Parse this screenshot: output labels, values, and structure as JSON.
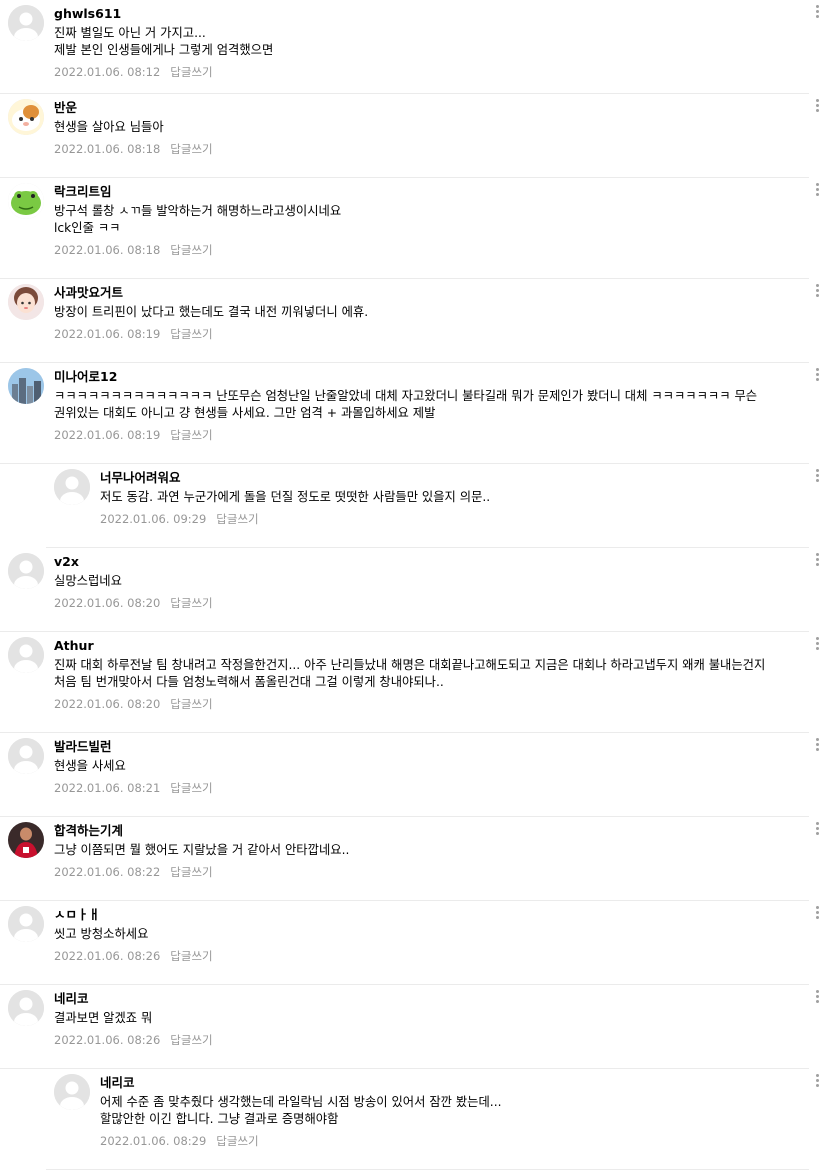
{
  "comments": [
    {
      "nick": "ghwls611",
      "text": "진짜 별일도 아닌 거 가지고...\n제발 본인 인생들에게나 그렇게 엄격했으면",
      "date": "2022.01.06. 08:12",
      "reply_label": "답글쓰기",
      "avatar": "default"
    },
    {
      "nick": "반운",
      "text": "현생을 살아요 님들아",
      "date": "2022.01.06. 08:18",
      "reply_label": "답글쓰기",
      "avatar": "hamster"
    },
    {
      "nick": "락크리트임",
      "text": "방구석 롤창 ㅅㄲ들 발악하는거 해명하느라고생이시네요\nlck인줄 ㅋㅋ",
      "date": "2022.01.06. 08:18",
      "reply_label": "답글쓰기",
      "avatar": "frog"
    },
    {
      "nick": "사과맛요거트",
      "text": "방장이 트리핀이 났다고 했는데도 결국 내전 끼워넣더니 에휴.",
      "date": "2022.01.06. 08:19",
      "reply_label": "답글쓰기",
      "avatar": "girl"
    },
    {
      "nick": "미나어로12",
      "text": "ㅋㅋㅋㅋㅋㅋㅋㅋㅋㅋㅋㅋㅋㅋ 난또무슨 엄청난일 난줄알았네 대체 자고왔더니 불타길래 뭐가 문제인가 봤더니 대체 ㅋㅋㅋㅋㅋㅋㅋ 무슨 권위있는 대회도 아니고 걍 현생들 사세요. 그만 엄격 + 과몰입하세요 제발",
      "date": "2022.01.06. 08:19",
      "reply_label": "답글쓰기",
      "avatar": "city"
    },
    {
      "nick": "너무나어려워요",
      "text": "저도 동감. 과연 누군가에게 돌을 던질 정도로 떳떳한 사람들만 있을지 의문..",
      "date": "2022.01.06. 09:29",
      "reply_label": "답글쓰기",
      "avatar": "default",
      "reply": true
    },
    {
      "nick": "v2x",
      "text": "실망스럽네요",
      "date": "2022.01.06. 08:20",
      "reply_label": "답글쓰기",
      "avatar": "default"
    },
    {
      "nick": "Athur",
      "text": "진짜 대회 하루전날 팀 창내려고 작정을한건지... 아주 난리들났내 해명은 대회끝나고해도되고 지금은 대회나 하라고냅두지 왜캐 불내는건지 처음 팀 번개맞아서 다들 엄청노력해서 폼올린건대 그걸 이렇게 창내야되나..",
      "date": "2022.01.06. 08:20",
      "reply_label": "답글쓰기",
      "avatar": "default"
    },
    {
      "nick": "발라드빌런",
      "text": "현생을 사세요",
      "date": "2022.01.06. 08:21",
      "reply_label": "답글쓰기",
      "avatar": "default"
    },
    {
      "nick": "합격하는기계",
      "text": "그냥 이쯤되면 뭘 했어도 지랄났을 거 같아서 안타깝네요..",
      "date": "2022.01.06. 08:22",
      "reply_label": "답글쓰기",
      "avatar": "player"
    },
    {
      "nick": "ㅅㅁㅏㅐ",
      "text": "씻고 방청소하세요",
      "date": "2022.01.06. 08:26",
      "reply_label": "답글쓰기",
      "avatar": "default"
    },
    {
      "nick": "네리코",
      "text": "결과보면 알겠죠 뭐",
      "date": "2022.01.06. 08:26",
      "reply_label": "답글쓰기",
      "avatar": "default"
    },
    {
      "nick": "네리코",
      "text": "어제 수준 좀 맞추줬다 생각했는데 라일락님 시점 방송이 있어서 잠깐 봤는데...\n할많안한 이긴 합니다. 그냥 결과로 증명해야함",
      "date": "2022.01.06. 08:29",
      "reply_label": "답글쓰기",
      "avatar": "default",
      "reply": true
    }
  ]
}
